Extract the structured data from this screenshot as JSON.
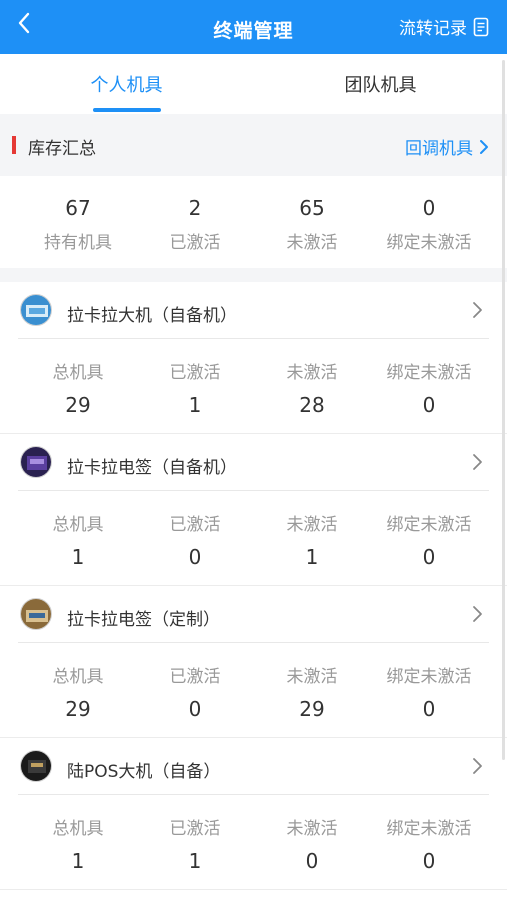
{
  "header": {
    "title": "终端管理",
    "right_label": "流转记录",
    "back_icon": "chevron-left-icon",
    "record_icon": "document-icon"
  },
  "tabs": [
    {
      "label": "个人机具",
      "active": true
    },
    {
      "label": "团队机具",
      "active": false
    }
  ],
  "summary": {
    "title": "库存汇总",
    "link": "回调机具",
    "stats": [
      {
        "value": "67",
        "label": "持有机具"
      },
      {
        "value": "2",
        "label": "已激活"
      },
      {
        "value": "65",
        "label": "未激活"
      },
      {
        "value": "0",
        "label": "绑定未激活"
      }
    ]
  },
  "devices": [
    {
      "name": "拉卡拉大机（自备机）",
      "stats": [
        {
          "label": "总机具",
          "value": "29"
        },
        {
          "label": "已激活",
          "value": "1"
        },
        {
          "label": "未激活",
          "value": "28"
        },
        {
          "label": "绑定未激活",
          "value": "0"
        }
      ]
    },
    {
      "name": "拉卡拉电签（自备机）",
      "stats": [
        {
          "label": "总机具",
          "value": "1"
        },
        {
          "label": "已激活",
          "value": "0"
        },
        {
          "label": "未激活",
          "value": "1"
        },
        {
          "label": "绑定未激活",
          "value": "0"
        }
      ]
    },
    {
      "name": "拉卡拉电签（定制）",
      "stats": [
        {
          "label": "总机具",
          "value": "29"
        },
        {
          "label": "已激活",
          "value": "0"
        },
        {
          "label": "未激活",
          "value": "29"
        },
        {
          "label": "绑定未激活",
          "value": "0"
        }
      ]
    },
    {
      "name": "陆POS大机（自备）",
      "stats": [
        {
          "label": "总机具",
          "value": "1"
        },
        {
          "label": "已激活",
          "value": "1"
        },
        {
          "label": "未激活",
          "value": "0"
        },
        {
          "label": "绑定未激活",
          "value": "0"
        }
      ]
    }
  ],
  "colors": {
    "primary": "#1e90f6",
    "accent_mark": "#e53935",
    "muted_text": "#999999"
  }
}
